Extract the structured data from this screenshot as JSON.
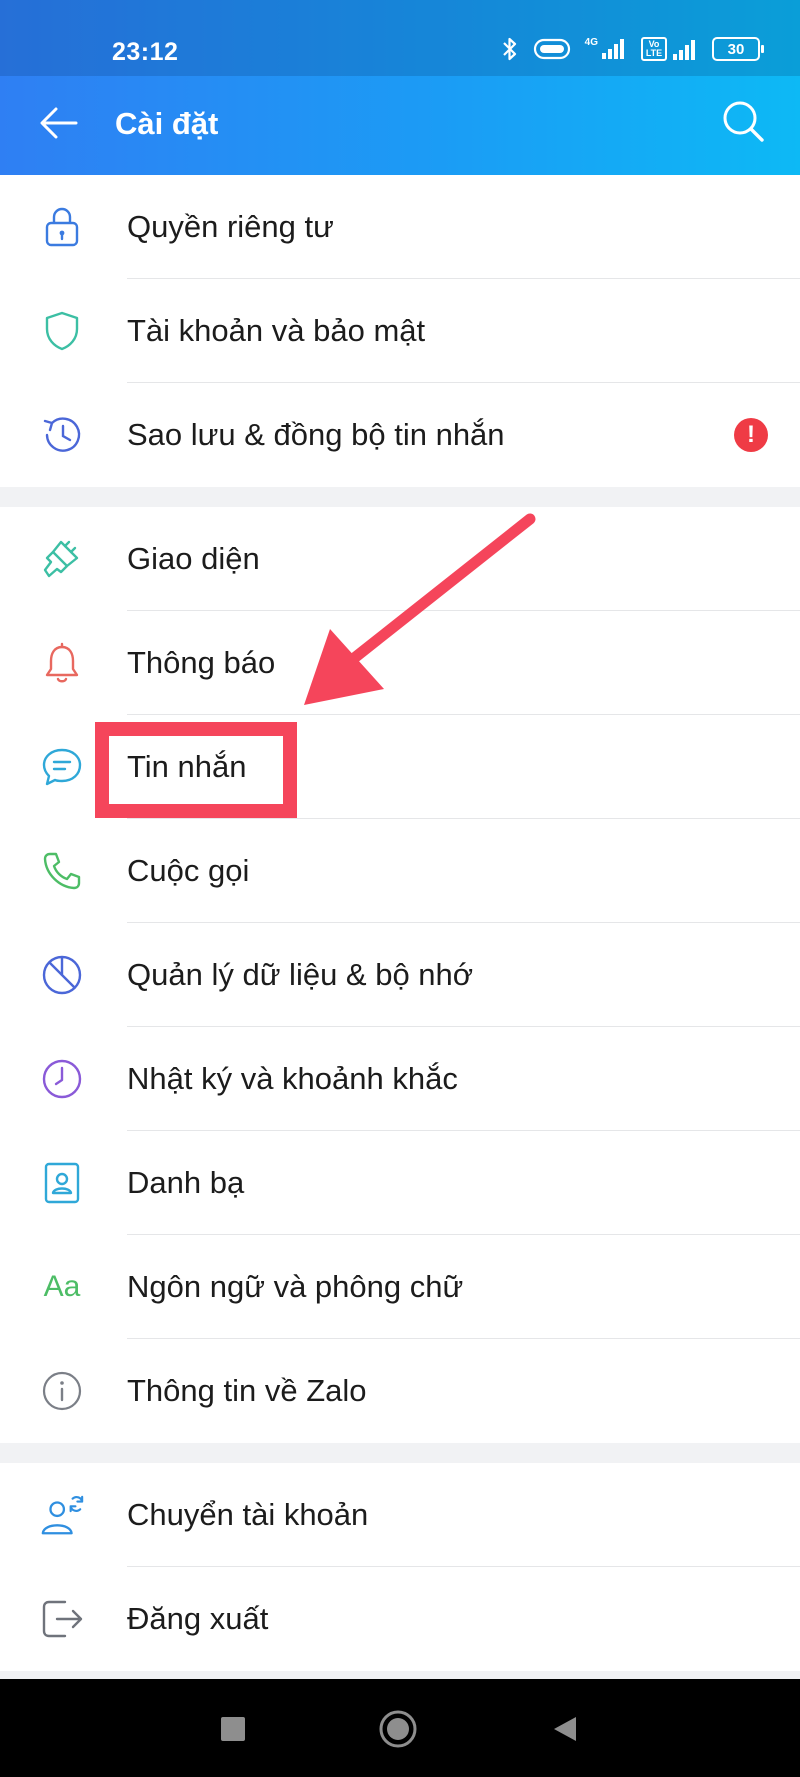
{
  "status_bar": {
    "time": "23:12",
    "network_1": "4G",
    "network_2": "Vo LTE",
    "battery": "30"
  },
  "header": {
    "title": "Cài đặt",
    "back_icon": "arrow-left-icon",
    "search_icon": "search-icon"
  },
  "groups": [
    {
      "items": [
        {
          "label": "Quyền riêng tư",
          "icon": "lock-icon"
        },
        {
          "label": "Tài khoản và bảo mật",
          "icon": "shield-icon"
        },
        {
          "label": "Sao lưu & đồng bộ tin nhắn",
          "icon": "history-icon",
          "badge": "!"
        }
      ]
    },
    {
      "items": [
        {
          "label": "Giao diện",
          "icon": "paint-brush-icon"
        },
        {
          "label": "Thông báo",
          "icon": "bell-icon"
        },
        {
          "label": "Tin nhắn",
          "icon": "chat-bubble-icon"
        },
        {
          "label": "Cuộc gọi",
          "icon": "phone-icon"
        },
        {
          "label": "Quản lý dữ liệu & bộ nhớ",
          "icon": "pie-chart-icon"
        },
        {
          "label": "Nhật ký và khoảnh khắc",
          "icon": "clock-icon"
        },
        {
          "label": "Danh bạ",
          "icon": "contact-card-icon"
        },
        {
          "label": "Ngôn ngữ và phông chữ",
          "icon": "font-aa-icon",
          "icon_text": "Aa"
        },
        {
          "label": "Thông tin về Zalo",
          "icon": "info-icon"
        }
      ]
    },
    {
      "items": [
        {
          "label": "Chuyển tài khoản",
          "icon": "switch-account-icon"
        },
        {
          "label": "Đăng xuất",
          "icon": "logout-icon"
        }
      ]
    }
  ],
  "annotation": {
    "highlight_color": "#f5455b",
    "target": "Tin nhắn"
  },
  "colors": {
    "header_gradient_start": "#2f7ff3",
    "header_gradient_end": "#0db9f5",
    "badge": "#ef3b45"
  },
  "nav_bar": {
    "recents_icon": "square-icon",
    "home_icon": "circle-icon",
    "back_icon": "triangle-back-icon"
  }
}
